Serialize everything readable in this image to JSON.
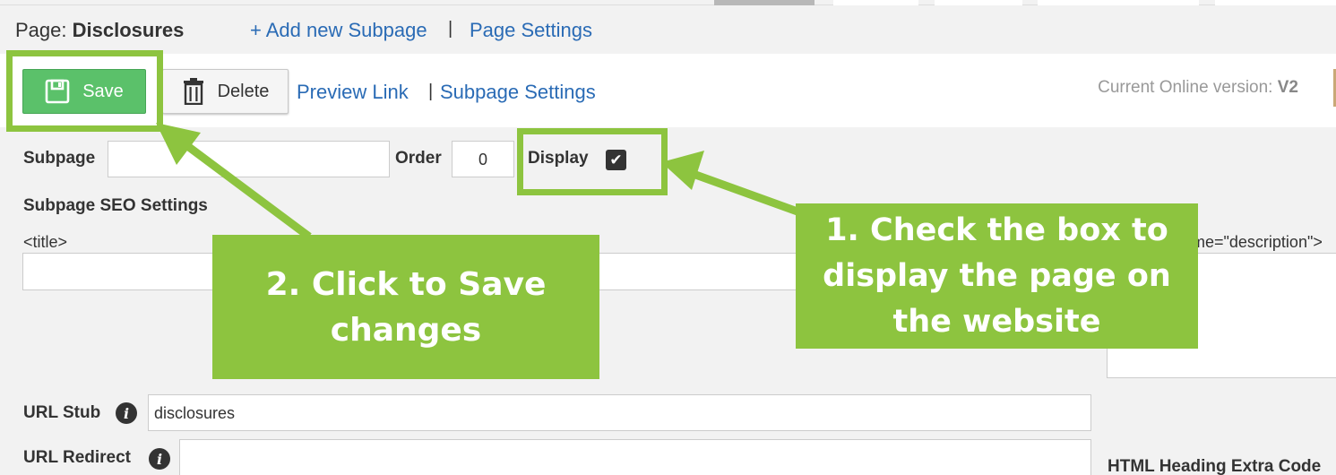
{
  "header": {
    "page_prefix": "Page:",
    "page_name": "Disclosures",
    "add_subpage": "+ Add new Subpage",
    "separator": "|",
    "page_settings": "Page Settings"
  },
  "toolbar": {
    "save_label": "Save",
    "delete_label": "Delete",
    "preview_link": "Preview Link",
    "separator": "|",
    "subpage_settings": "Subpage Settings",
    "version_label": "Current Online version:",
    "version_value": "V2"
  },
  "form": {
    "subpage_label": "Subpage",
    "subpage_value": "",
    "order_label": "Order",
    "order_value": "0",
    "display_label": "Display",
    "display_checked": true,
    "seo_heading": "Subpage SEO Settings",
    "title_tag_label": "<title>",
    "meta_description_label": "me=\"description\">",
    "url_stub_label": "URL Stub",
    "url_stub_value": "disclosures",
    "url_redirect_label": "URL Redirect",
    "url_redirect_value": "",
    "html_heading_label": "HTML Heading Extra Code"
  },
  "annotations": {
    "callout_1": [
      "1. Check the box to",
      "display the page on",
      "the website"
    ],
    "callout_2": [
      "2. Click to Save",
      "changes"
    ]
  },
  "colors": {
    "highlight": "#8dc43f",
    "save_button": "#5bc16a",
    "link": "#2a6bb5"
  }
}
